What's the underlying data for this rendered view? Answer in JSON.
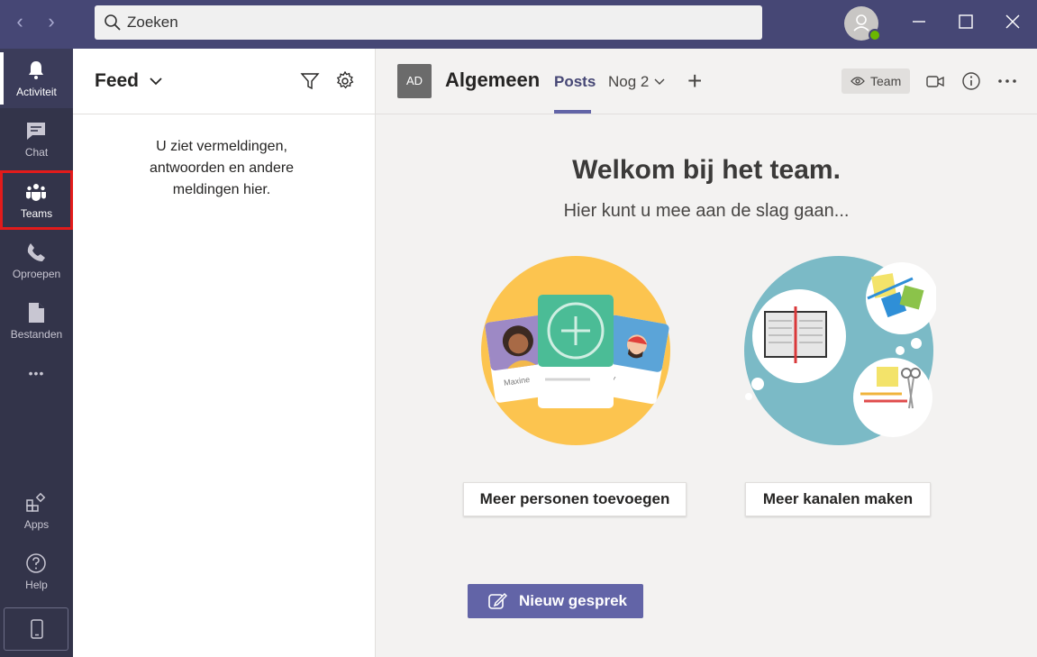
{
  "titlebar": {
    "search_placeholder": "Zoeken",
    "nav_back": "‹",
    "nav_forward": "›"
  },
  "rail": {
    "items": [
      {
        "label": "Activiteit",
        "icon": "bell-icon"
      },
      {
        "label": "Chat",
        "icon": "chat-icon"
      },
      {
        "label": "Teams",
        "icon": "teams-icon"
      },
      {
        "label": "Oproepen",
        "icon": "phone-icon"
      },
      {
        "label": "Bestanden",
        "icon": "file-icon"
      },
      {
        "label": "Apps",
        "icon": "apps-icon"
      },
      {
        "label": "Help",
        "icon": "help-icon"
      }
    ],
    "more": "•••"
  },
  "feed": {
    "title": "Feed",
    "empty_text": "U ziet vermeldingen, antwoorden en andere meldingen hier."
  },
  "channel": {
    "team_avatar": "AD",
    "title": "Algemeen",
    "tabs": [
      {
        "label": "Posts"
      },
      {
        "label": "Nog 2"
      }
    ],
    "add_tab": "+",
    "team_button": "Team"
  },
  "welcome": {
    "title": "Welkom bij het team.",
    "subtitle": "Hier kunt u mee aan de slag gaan...",
    "card_name_1": "Maxine",
    "card_name_2": "ky"
  },
  "actions": {
    "add_people": "Meer personen toevoegen",
    "add_channels": "Meer kanalen maken",
    "new_conversation": "Nieuw gesprek"
  },
  "colors": {
    "titlebar": "#464775",
    "rail": "#33344a",
    "accent": "#6264a7",
    "highlight": "#e21b1b",
    "status_available": "#6bb700"
  }
}
